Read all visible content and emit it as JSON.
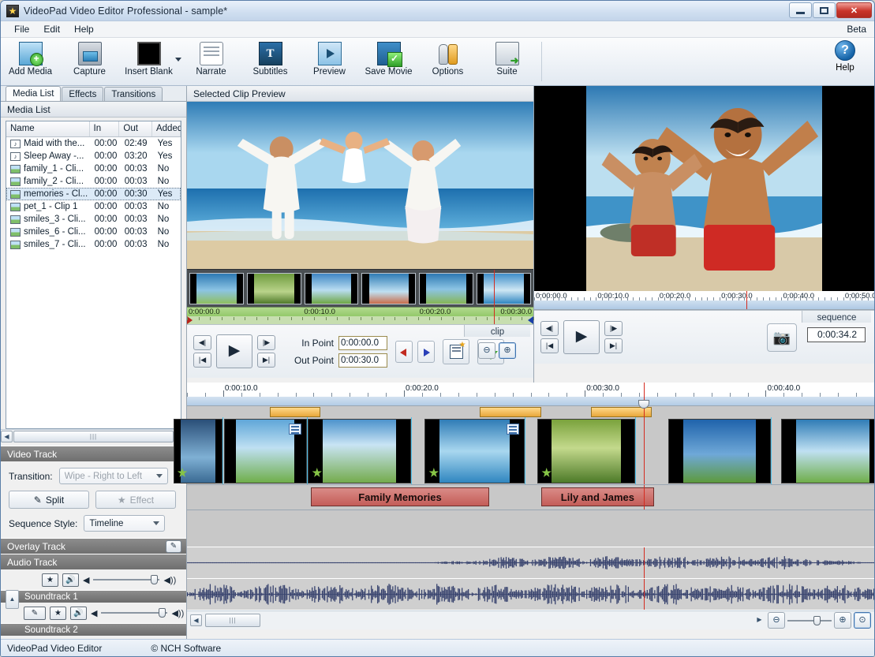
{
  "window": {
    "title": "VideoPad Video Editor Professional - sample*",
    "app_icon": "videopad-icon",
    "minimize": "minimize-button",
    "maximize": "maximize-button",
    "close": "✕"
  },
  "menu": {
    "items": [
      "File",
      "Edit",
      "Help"
    ],
    "beta_label": "Beta"
  },
  "toolbar": {
    "buttons": [
      {
        "label": "Add Media",
        "icon": "add-media-icon"
      },
      {
        "label": "Capture",
        "icon": "capture-icon"
      },
      {
        "label": "Insert Blank",
        "icon": "insert-blank-icon"
      },
      {
        "label": "Narrate",
        "icon": "narrate-icon"
      },
      {
        "label": "Subtitles",
        "icon": "subtitles-icon"
      },
      {
        "label": "Preview",
        "icon": "preview-icon"
      },
      {
        "label": "Save Movie",
        "icon": "save-movie-icon"
      },
      {
        "label": "Options",
        "icon": "options-icon"
      },
      {
        "label": "Suite",
        "icon": "suite-icon"
      }
    ],
    "help_label": "Help"
  },
  "left_panel": {
    "tabs": [
      {
        "label": "Media List",
        "active": true
      },
      {
        "label": "Effects",
        "active": false
      },
      {
        "label": "Transitions",
        "active": false
      }
    ],
    "section_title": "Media List",
    "columns": [
      "Name",
      "In",
      "Out",
      "Added"
    ],
    "rows": [
      {
        "name": "Maid with the...",
        "in": "00:00",
        "out": "02:49",
        "added": "Yes",
        "kind": "audio",
        "selected": false
      },
      {
        "name": "Sleep Away -...",
        "in": "00:00",
        "out": "03:20",
        "added": "Yes",
        "kind": "audio",
        "selected": false
      },
      {
        "name": "family_1 - Cli...",
        "in": "00:00",
        "out": "00:03",
        "added": "No",
        "kind": "video",
        "selected": false
      },
      {
        "name": "family_2 - Cli...",
        "in": "00:00",
        "out": "00:03",
        "added": "No",
        "kind": "video",
        "selected": false
      },
      {
        "name": "memories - Cl...",
        "in": "00:00",
        "out": "00:30",
        "added": "Yes",
        "kind": "video",
        "selected": true
      },
      {
        "name": "pet_1 - Clip 1",
        "in": "00:00",
        "out": "00:03",
        "added": "No",
        "kind": "video",
        "selected": false
      },
      {
        "name": "smiles_3 - Cli...",
        "in": "00:00",
        "out": "00:03",
        "added": "No",
        "kind": "video",
        "selected": false
      },
      {
        "name": "smiles_6 - Cli...",
        "in": "00:00",
        "out": "00:03",
        "added": "No",
        "kind": "video",
        "selected": false
      },
      {
        "name": "smiles_7 - Cli...",
        "in": "00:00",
        "out": "00:03",
        "added": "No",
        "kind": "video",
        "selected": false
      }
    ]
  },
  "video_track_panel": {
    "header": "Video Track",
    "transition_label": "Transition:",
    "transition_value": "Wipe - Right to Left",
    "split_label": "Split",
    "effect_label": "Effect",
    "sequence_style_label": "Sequence Style:",
    "sequence_style_value": "Timeline"
  },
  "overlay_track_panel": {
    "header": "Overlay Track",
    "edit_icon": "pencil-icon"
  },
  "audio_track_panel": {
    "header": "Audio Track",
    "soundtracks": [
      {
        "label": "Soundtrack 1"
      },
      {
        "label": "Soundtrack 2"
      }
    ]
  },
  "clip_preview": {
    "header": "Selected Clip Preview",
    "tag": "clip",
    "in_point_label": "In Point",
    "in_point_value": "0:00:00.0",
    "out_point_label": "Out Point",
    "out_point_value": "0:00:30.0",
    "ruler_labels": [
      "0:00:00.0",
      "0:00:10.0",
      "0:00:20.0",
      "0:00:30.0"
    ]
  },
  "sequence_preview": {
    "tag": "sequence",
    "timecode": "0:00:34.2",
    "snapshot_icon": "camera-icon",
    "ruler_labels": [
      "0:00:00.0",
      "0:00:10.0",
      "0:00:20.0",
      "0:00:30.0",
      "0:00:40.0",
      "0:00:50.0"
    ]
  },
  "timeline": {
    "ruler_labels": [
      "0:00:10.0",
      "0:00:20.0",
      "0:00:30.0",
      "0:00:40.0"
    ],
    "playhead_position_pct": 66.5,
    "text_clips": [
      {
        "text": "Family Memories",
        "left_pct": 18.0,
        "width_pct": 26.0
      },
      {
        "text": "Lily and James",
        "left_pct": 51.5,
        "width_pct": 16.5
      }
    ]
  },
  "status_bar": {
    "app_name": "VideoPad Video Editor",
    "copyright": "© NCH Software"
  }
}
